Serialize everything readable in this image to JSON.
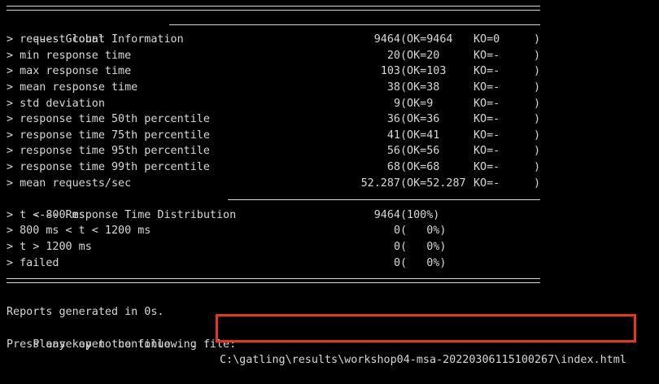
{
  "terminal": {
    "sections": {
      "global": "---- Global Information ",
      "distribution": "---- Response Time Distribution "
    },
    "stats": [
      {
        "label": "> request count",
        "value": "9464",
        "ok": "(OK=9464",
        "ko": "KO=0",
        "close": ")"
      },
      {
        "label": "> min response time",
        "value": "20",
        "ok": "(OK=20",
        "ko": "KO=-",
        "close": ")"
      },
      {
        "label": "> max response time",
        "value": "103",
        "ok": "(OK=103",
        "ko": "KO=-",
        "close": ")"
      },
      {
        "label": "> mean response time",
        "value": "38",
        "ok": "(OK=38",
        "ko": "KO=-",
        "close": ")"
      },
      {
        "label": "> std deviation",
        "value": "9",
        "ok": "(OK=9",
        "ko": "KO=-",
        "close": ")"
      },
      {
        "label": "> response time 50th percentile",
        "value": "36",
        "ok": "(OK=36",
        "ko": "KO=-",
        "close": ")"
      },
      {
        "label": "> response time 75th percentile",
        "value": "41",
        "ok": "(OK=41",
        "ko": "KO=-",
        "close": ")"
      },
      {
        "label": "> response time 95th percentile",
        "value": "56",
        "ok": "(OK=56",
        "ko": "KO=-",
        "close": ")"
      },
      {
        "label": "> response time 99th percentile",
        "value": "68",
        "ok": "(OK=68",
        "ko": "KO=-",
        "close": ")"
      },
      {
        "label": "> mean requests/sec",
        "value": "52.287",
        "ok": "(OK=52.287",
        "ko": "KO=-",
        "close": ")"
      }
    ],
    "distribution": [
      {
        "label": "> t < 800 ms",
        "value": "9464",
        "pct": "(100%)"
      },
      {
        "label": "> 800 ms < t < 1200 ms",
        "value": "0",
        "pct": "(   0%)"
      },
      {
        "label": "> t > 1200 ms",
        "value": "0",
        "pct": "(   0%)"
      },
      {
        "label": "> failed",
        "value": "0",
        "pct": "(   0%)"
      }
    ],
    "footer": {
      "reports_line": "Reports generated in 0s.",
      "open_prompt": "Please open the following file:",
      "file_path": "C:\\gatling\\results\\workshop04-msa-20220306115100267\\index.html",
      "continue_line": "Press any key to continue . . ."
    },
    "colors": {
      "background": "#000000",
      "text": "#d8d8d8",
      "highlight": "#e8351c"
    }
  }
}
